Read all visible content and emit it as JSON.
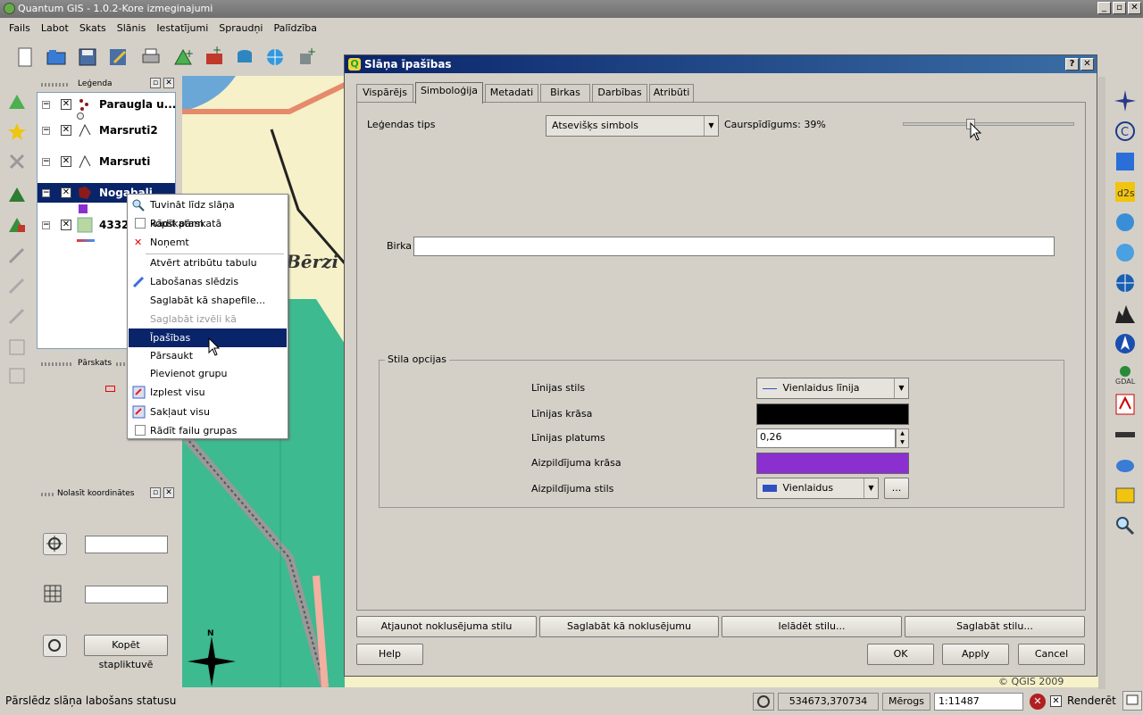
{
  "window": {
    "title": "Quantum GIS - 1.0.2-Kore  izmeginajumi",
    "btn_min": "_",
    "btn_max": "▫",
    "btn_close": "✕"
  },
  "menu": [
    "Fails",
    "Labot",
    "Skats",
    "Slānis",
    "Iestatījumi",
    "Spraudņi",
    "Palīdzība"
  ],
  "legend_panel": {
    "title": "Leģenda",
    "layers": [
      {
        "name": "Paraugla u..."
      },
      {
        "name": "Marsruti2"
      },
      {
        "name": "Marsruti"
      },
      {
        "name": "Nogabali"
      },
      {
        "name": "4332_"
      }
    ]
  },
  "overview_panel": {
    "title": "Pārskats"
  },
  "coords_panel": {
    "title": "Nolasīt koordinātes",
    "copy_button": "Kopēt stapliktuvē"
  },
  "context_menu": {
    "items": [
      {
        "label": "Tuvināt līdz slāņa kopskatam"
      },
      {
        "label": "Rādīt pārskatā"
      },
      {
        "label": "Noņemt"
      },
      {
        "label": "Atvērt atribūtu tabulu"
      },
      {
        "label": "Labošanas slēdzis"
      },
      {
        "label": "Saglabāt kā shapefile..."
      },
      {
        "label": "Saglabāt izvēli kā shapefile..."
      },
      {
        "label": "Īpašības"
      },
      {
        "label": "Pārsaukt"
      },
      {
        "label": "Pievienot grupu"
      },
      {
        "label": "Izplest visu"
      },
      {
        "label": "Sakļaut visu"
      },
      {
        "label": "Rādīt failu grupas"
      }
    ]
  },
  "dialog": {
    "title": "Slāņa īpašības",
    "help_q": "?",
    "close": "✕",
    "tabs": [
      "Vispārējs",
      "Simboloģija",
      "Metadati",
      "Birkas",
      "Darbības",
      "Atribūti"
    ],
    "legend_type_label": "Leģendas tips",
    "legend_type_value": "Atsevišķs simbols",
    "transparency_label": "Caurspīdīgums: 39%",
    "transparency_value": 0.39,
    "label_field_label": "Birka",
    "label_field_value": "",
    "style_group_title": "Stila opcijas",
    "line_style_label": "Līnijas stils",
    "line_style_value": "Vienlaidus līnija",
    "line_color_label": "Līnijas krāsa",
    "line_color": "#000000",
    "line_width_label": "Līnijas platums",
    "line_width_value": "0,26",
    "fill_color_label": "Aizpildījuma krāsa",
    "fill_color": "#8b2fd1",
    "fill_style_label": "Aizpildījuma stils",
    "fill_style_value": "Vienlaidus",
    "fill_style_more": "...",
    "buttons": {
      "restore_default": "Atjaunot noklusējuma stilu",
      "save_default": "Saglabāt kā noklusējumu",
      "load_style": "Ielādēt stilu...",
      "save_style": "Saglabāt stilu...",
      "help": "Help",
      "ok": "OK",
      "apply": "Apply",
      "cancel": "Cancel"
    }
  },
  "map_text": {
    "place_label": "Bērzi",
    "north": "N",
    "copyright": "© QGIS 2009"
  },
  "statusbar": {
    "message": "Pārslēdz slāņa labošans statusu",
    "coordinates": "534673,370734",
    "scale_label": "Mērogs",
    "scale_value": "1:11487",
    "render_label": "Renderēt"
  }
}
